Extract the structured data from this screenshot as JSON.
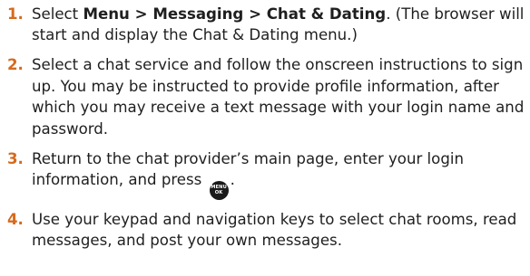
{
  "steps": [
    {
      "number": "1.",
      "text_a": "Select ",
      "bold": "Menu > Messaging > Chat & Dating",
      "text_b": ". (The browser will start and display the Chat & Dating menu.)"
    },
    {
      "number": "2.",
      "text": "Select a chat service and follow the onscreen instructions to sign up. You may be instructed to provide profile information, after which you may receive a text message with your login name and password."
    },
    {
      "number": "3.",
      "text_a": "Return to the chat provider’s main page, enter your login information, and press ",
      "key_top": "MENU",
      "key_bottom": "OK",
      "text_b": "."
    },
    {
      "number": "4.",
      "text": "Use your keypad and navigation keys to select chat rooms, read messages, and post your own messages."
    }
  ]
}
